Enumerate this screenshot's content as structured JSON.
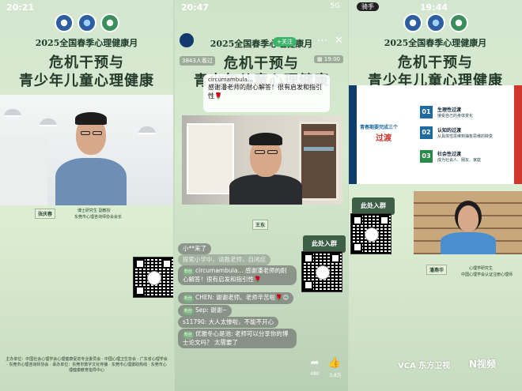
{
  "panel1": {
    "time": "20:21",
    "banner": "2025全国春季心理健康月",
    "title_line1": "危机干预与",
    "title_line2": "青少年儿童心理健康",
    "speaker_name": "张庆春",
    "speaker_caption_line1": "博士研究生 副教授",
    "speaker_caption_line2": "东莞市心理咨询师协会会长",
    "footer": "主办单位：中国社会心理学会心理健康促进专业委员会 · 中国心理卫生协会 · 广东省心理学会 · 东莞市心理咨询师协会 · 承办单位：东莞市数字文化传播 · 东莞市心理援助热线 · 东莞市心理健康教育指导中心"
  },
  "panel2": {
    "time": "20:47",
    "signal": "5G",
    "banner": "2025全国春季心理健康月",
    "follow_label": "+关注",
    "viewers": "3843人看过",
    "live_time": "19:00",
    "title_line1": "危机干预与",
    "title_line2": "青少年儿童心理健康",
    "pinned_user": "circumambula...",
    "pinned_comment": "感谢潘老师的耐心解答！很有启发和指引性🌹",
    "speaker_name": "王东",
    "join_label": "此处入群",
    "chat": [
      {
        "text": "小**来了"
      },
      {
        "text": "探索小学中，请教老师，自闭症"
      },
      {
        "level": "粉丝",
        "text": "circumambula... 感谢潘老师的耐心解答！很有启发和指引性🌹"
      },
      {
        "level": "粉丝",
        "text": "CHEN: 谢谢老师。老师辛苦啦🌹😊"
      },
      {
        "level": "粉丝",
        "text": "Sep: 谢谢~"
      },
      {
        "text": "s11790: 大人太惨啦，不能不开心"
      },
      {
        "level": "粉丝",
        "text": "优雅冬心是池: 老师可以分享你的博士论文吗？ 太需要了"
      }
    ],
    "share_count": "480",
    "like_count": "3.8万"
  },
  "panel3": {
    "app_label": "骑手",
    "time": "19:44",
    "banner": "2025全国春季心理健康月",
    "title_line1": "危机干预与",
    "title_line2": "青少年儿童心理健康",
    "slide_left_line1": "青春期要完成三个",
    "slide_left_line2": "过渡",
    "slide_items": [
      {
        "num": "01",
        "title": "生理性过渡",
        "desc": "接受自己的身体变化"
      },
      {
        "num": "02",
        "title": "认知的过渡",
        "desc": "从具体性思维到抽象思维的转变"
      },
      {
        "num": "03",
        "title": "社会性过渡",
        "desc": "成为社会人、朋友、家庭"
      }
    ],
    "join_label": "此处入群",
    "speaker_name": "潘燕华",
    "speaker_caption_line1": "心理学研究生",
    "speaker_caption_line2": "中国心理学会认证注册心理师",
    "watermark_left": "VCA 东方卫视",
    "watermark_right": "N视频"
  },
  "colors": {
    "accent_green": "#3d5f45",
    "title": "#243a2a",
    "slide_blue": "#1f6a9e",
    "slide_red": "#d0372c"
  }
}
